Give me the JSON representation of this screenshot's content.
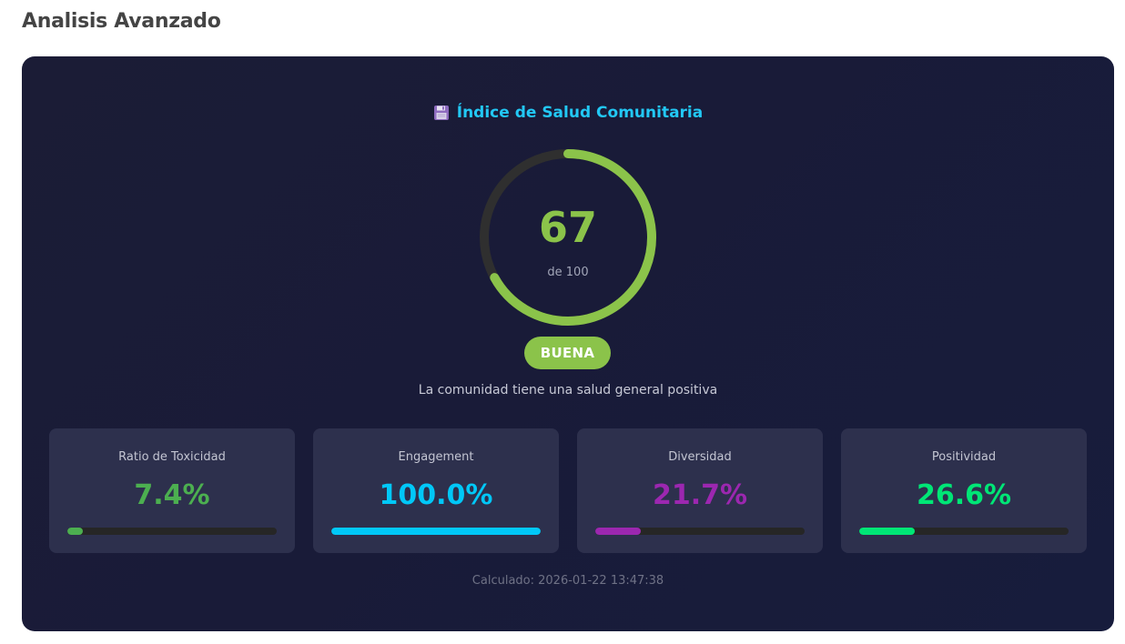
{
  "page": {
    "title": "Analisis Avanzado"
  },
  "health": {
    "icon": "floppy-disk-icon",
    "title": "Índice de Salud Comunitaria",
    "score": "67",
    "score_value": 67,
    "max_label": "de 100",
    "status": "BUENA",
    "description": "La comunidad tiene una salud general positiva",
    "accent_color": "#8bc34a",
    "track_color": "#2f2f2f"
  },
  "metrics": [
    {
      "label": "Ratio de Toxicidad",
      "value": "7.4%",
      "fraction": 0.074,
      "color": "#4caf50"
    },
    {
      "label": "Engagement",
      "value": "100.0%",
      "fraction": 1.0,
      "color": "#00c8f8"
    },
    {
      "label": "Diversidad",
      "value": "21.7%",
      "fraction": 0.217,
      "color": "#9c27b0"
    },
    {
      "label": "Positividad",
      "value": "26.6%",
      "fraction": 0.266,
      "color": "#00e676"
    }
  ],
  "calculated": "Calculado: 2026-01-22 13:47:38"
}
